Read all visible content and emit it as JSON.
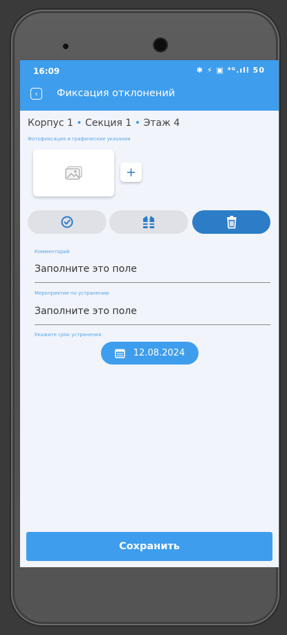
{
  "status_bar": {
    "time": "16:09",
    "icons": "✱ ⚡ ▣ ⁴ᴳ.ıll 50"
  },
  "header": {
    "title": "Фиксация отклонений"
  },
  "breadcrumb": {
    "building": "Корпус 1",
    "section": "Секция 1",
    "floor": "Этаж 4",
    "separator": "•"
  },
  "photo": {
    "label": "Фотофиксация и графические указания",
    "add_symbol": "+"
  },
  "fields": {
    "comment": {
      "label": "Комментарий",
      "value": "Заполните это поле"
    },
    "measure": {
      "label": "Мероприятие по устранению",
      "value": "Заполните это поле"
    },
    "deadline": {
      "label": "Укажите срок устранения",
      "date": "12.08.2024"
    }
  },
  "actions": {
    "save": "Сохранить"
  },
  "colors": {
    "accent": "#3e9ded",
    "accent_dark": "#2c7cc8",
    "segment_bg": "#dfe1e6"
  },
  "icons": {
    "segment_1": "check-circle-icon",
    "segment_2": "safety-vest-icon",
    "segment_3": "trash-icon"
  }
}
